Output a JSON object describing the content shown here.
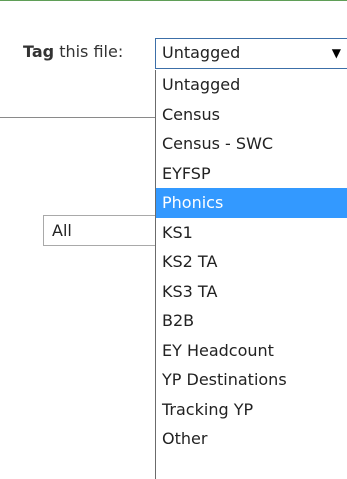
{
  "tag_label": {
    "bold_part": "Tag",
    "rest": " this file:"
  },
  "tag_select": {
    "value": "Untagged",
    "arrow_icon": "triangle-down-icon"
  },
  "filter_select": {
    "value": "All"
  },
  "dropdown": {
    "highlighted": "Phonics",
    "options": [
      "Untagged",
      "Census",
      "Census - SWC",
      "EYFSP",
      "Phonics",
      "KS1",
      "KS2 TA",
      "KS3 TA",
      "B2B",
      "EY Headcount",
      "YP Destinations",
      "Tracking YP",
      "Other"
    ]
  },
  "colors": {
    "highlight": "#3399ff",
    "top_rule": "#5f9e57",
    "select_border": "#3c6fa8"
  }
}
